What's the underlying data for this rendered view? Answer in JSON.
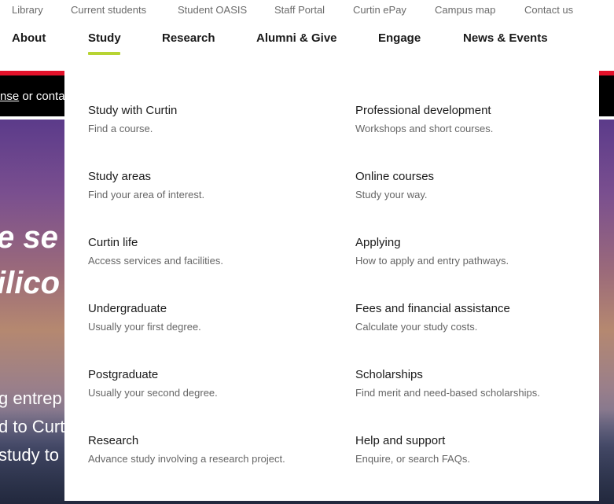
{
  "utility_nav": [
    "Library",
    "Current students",
    "Student OASIS",
    "Staff Portal",
    "Curtin ePay",
    "Campus map",
    "Contact us"
  ],
  "main_nav": {
    "items": [
      "About",
      "Study",
      "Research",
      "Alumni & Give",
      "Engage",
      "News & Events"
    ],
    "active": "Study",
    "active_color": "#b7d433"
  },
  "alert": {
    "link_fragment": "nse",
    "text_fragment": " or conta"
  },
  "hero": {
    "headline_fragments": [
      "e se",
      "ilico"
    ],
    "paragraph_fragments": [
      "g entrep",
      "d to Curt",
      " study to"
    ]
  },
  "dropdown": {
    "left_column": [
      {
        "title": "Study with Curtin",
        "subtitle": "Find a course."
      },
      {
        "title": "Study areas",
        "subtitle": "Find your area of interest."
      },
      {
        "title": "Curtin life",
        "subtitle": "Access services and facilities."
      },
      {
        "title": "Undergraduate",
        "subtitle": "Usually your first degree."
      },
      {
        "title": "Postgraduate",
        "subtitle": "Usually your second degree."
      },
      {
        "title": "Research",
        "subtitle": "Advance study involving a research project."
      }
    ],
    "right_column": [
      {
        "title": "Professional development",
        "subtitle": "Workshops and short courses."
      },
      {
        "title": "Online courses",
        "subtitle": "Study your way."
      },
      {
        "title": "Applying",
        "subtitle": "How to apply and entry pathways."
      },
      {
        "title": "Fees and financial assistance",
        "subtitle": "Calculate your study costs."
      },
      {
        "title": "Scholarships",
        "subtitle": "Find merit and need-based scholarships."
      },
      {
        "title": "Help and support",
        "subtitle": "Enquire, or search FAQs."
      }
    ]
  },
  "colors": {
    "brand_red": "#e4122b",
    "accent_green": "#b7d433"
  }
}
